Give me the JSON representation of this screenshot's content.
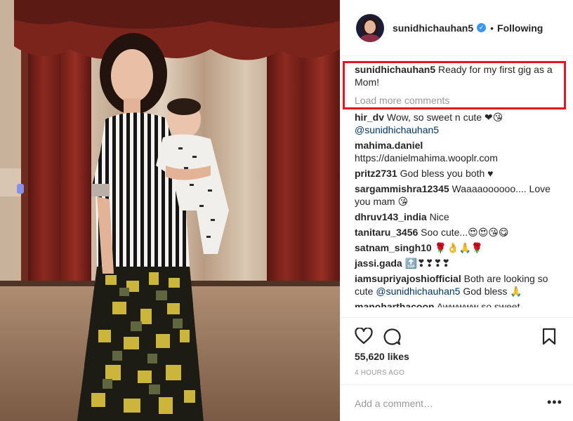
{
  "post": {
    "username": "sunidhichauhan5",
    "verified": true,
    "follow_state": "Following",
    "separator": "•",
    "caption": "Ready for my first gig as a Mom!",
    "load_more": "Load more comments",
    "likes": "55,620 likes",
    "time": "4 HOURS AGO",
    "add_comment_placeholder": "Add a comment…",
    "more_options": "•••"
  },
  "comments": [
    {
      "user": "hir_dv",
      "text": "Wow, so sweet n cute ❤😘",
      "mention": "@sunidhichauhan5"
    },
    {
      "user": "mahima.daniel",
      "text": "https://danielmahima.wooplr.com",
      "mention": ""
    },
    {
      "user": "pritz2731",
      "text": "God bless you both ♥",
      "mention": ""
    },
    {
      "user": "sargammishra12345",
      "text": "Waaaaoooooo.... Love you mam 😘",
      "mention": ""
    },
    {
      "user": "dhruv143_india",
      "text": "Nice",
      "mention": ""
    },
    {
      "user": "tanitaru_3456",
      "text": "Soo cute...😍😍😘😋",
      "mention": ""
    },
    {
      "user": "satnam_singh10",
      "text": "🌹👌🙏🌹",
      "mention": ""
    },
    {
      "user": "jassi.gada",
      "text": "🔝❣❣❣❣",
      "mention": ""
    },
    {
      "user": "iamsupriyajoshiofficial",
      "text": "Both are looking so cute",
      "mention": "@sunidhichauhan5",
      "text_after": "God bless 🙏"
    },
    {
      "user": "manoharthacoon",
      "text": "Awwwww so sweet",
      "mention": ""
    }
  ],
  "icons": {
    "like": "heart-icon",
    "comment": "comment-icon",
    "save": "bookmark-icon"
  },
  "colors": {
    "link": "#003569",
    "verified": "#3897f0",
    "highlight_border": "#e8141f",
    "muted": "#999999"
  }
}
